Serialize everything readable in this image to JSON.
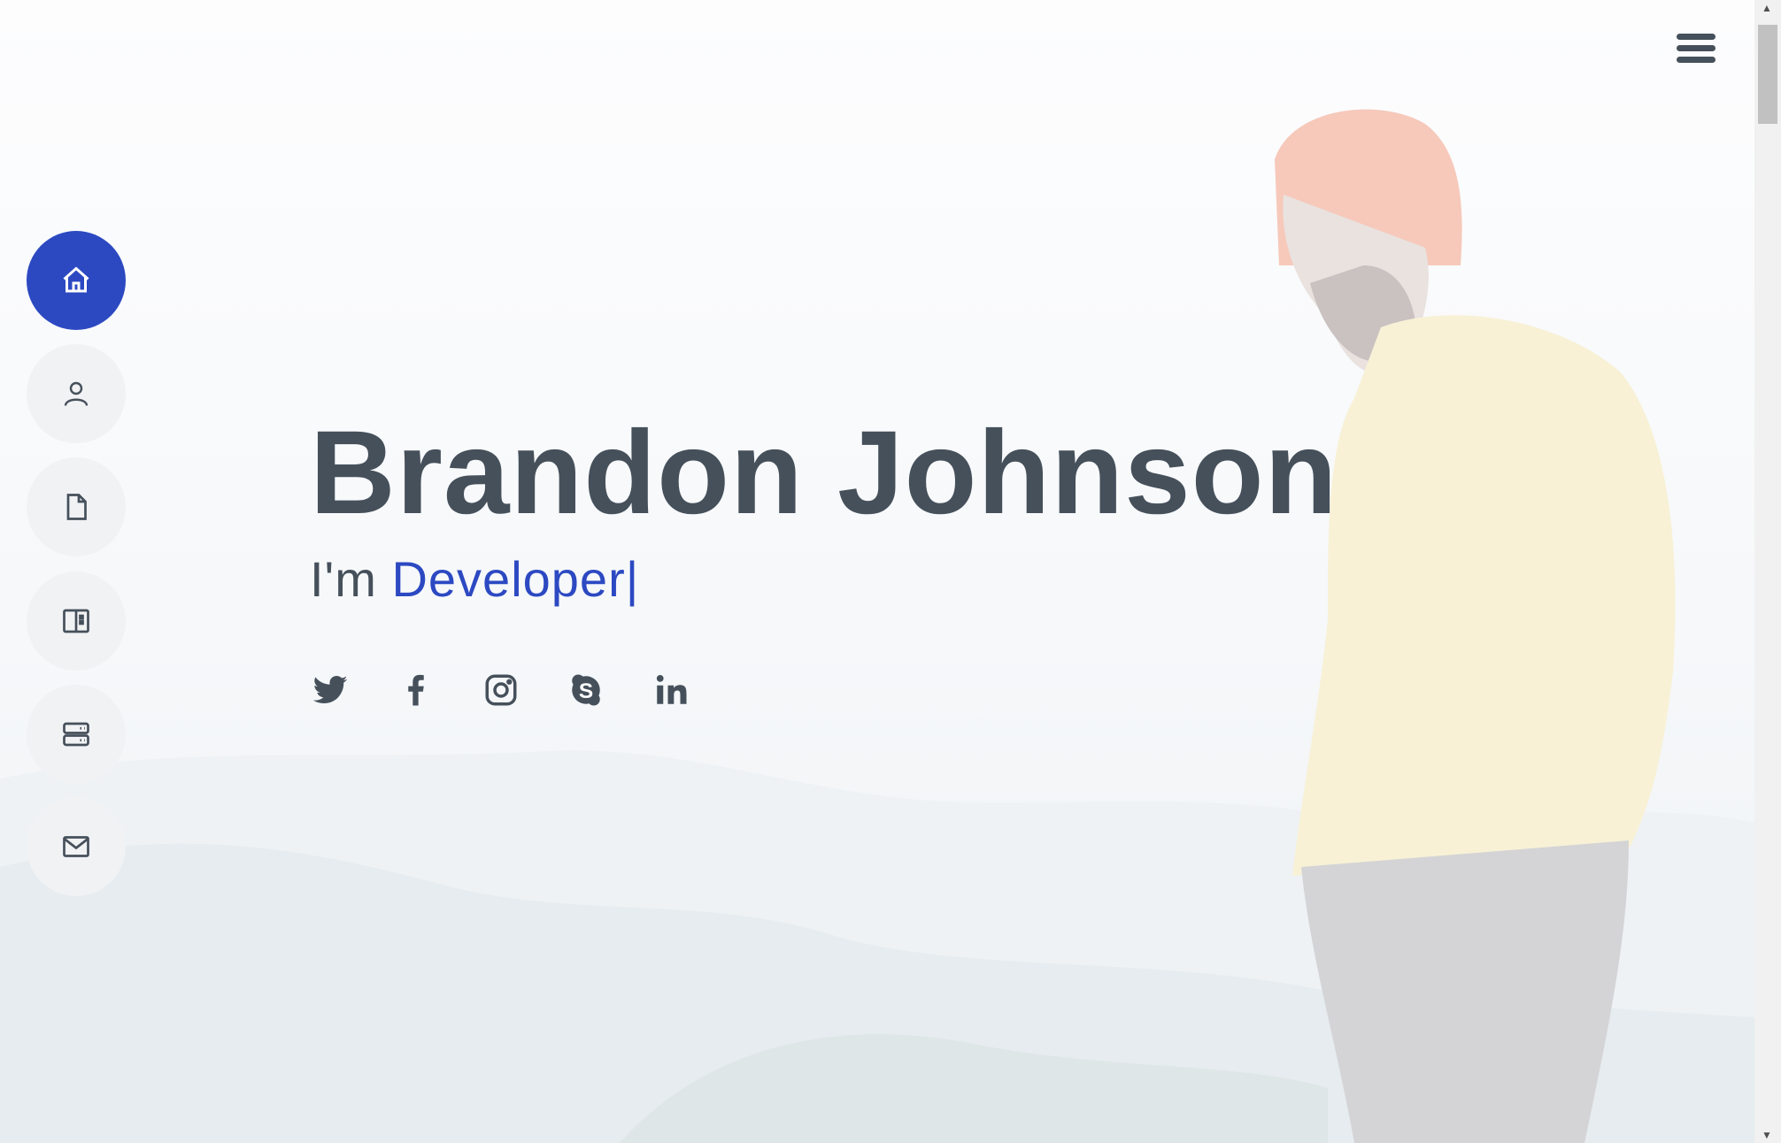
{
  "hero": {
    "name": "Brandon Johnson",
    "prefix": "I'm ",
    "role": "Developer",
    "cursor": "|"
  },
  "nav": [
    {
      "id": "home",
      "icon": "home-icon",
      "active": true
    },
    {
      "id": "about",
      "icon": "person-icon"
    },
    {
      "id": "resume",
      "icon": "file-icon"
    },
    {
      "id": "portfolio",
      "icon": "book-icon"
    },
    {
      "id": "services",
      "icon": "server-icon"
    },
    {
      "id": "contact",
      "icon": "envelope-icon"
    }
  ],
  "social": [
    "twitter-icon",
    "facebook-icon",
    "instagram-icon",
    "skype-icon",
    "linkedin-icon"
  ],
  "colors": {
    "accent": "#2c49c2",
    "text": "#45505b",
    "nav_bg": "#f1f2f4"
  }
}
